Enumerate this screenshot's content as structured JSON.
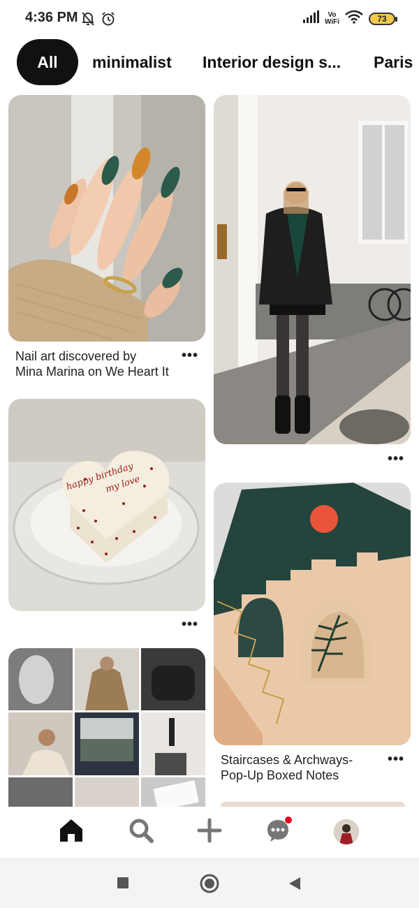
{
  "status_bar": {
    "time": "4:36 PM",
    "vowifi_line1": "Vo",
    "vowifi_line2": "WiFi",
    "battery": "73",
    "icons": [
      "mute-bell-icon",
      "alarm-icon",
      "signal-icon",
      "wifi-icon",
      "battery-icon"
    ]
  },
  "filters": {
    "items": [
      {
        "label": "All",
        "selected": true
      },
      {
        "label": "minimalist"
      },
      {
        "label": "Interior design s..."
      },
      {
        "label": "Paris"
      }
    ]
  },
  "pins": {
    "left": [
      {
        "caption_line1": "Nail art  discovered by",
        "caption_line2": "Mina Marina on We Heart It",
        "more": "•••"
      },
      {
        "more": "•••"
      },
      {}
    ],
    "right": [
      {
        "more": "•••"
      },
      {
        "caption_line1": "Staircases & Archways-",
        "caption_line2": "Pop-Up Boxed Notes",
        "more": "•••"
      }
    ],
    "cake_text_line1": "happy birthday",
    "cake_text_line2": "my love"
  },
  "bottom_nav": {
    "items": [
      "home-icon",
      "search-icon",
      "create-icon",
      "messages-icon",
      "profile-avatar"
    ],
    "accent": "#e60023"
  },
  "system_nav": {
    "items": [
      "recent-apps-icon",
      "home-circle-icon",
      "back-icon"
    ]
  }
}
